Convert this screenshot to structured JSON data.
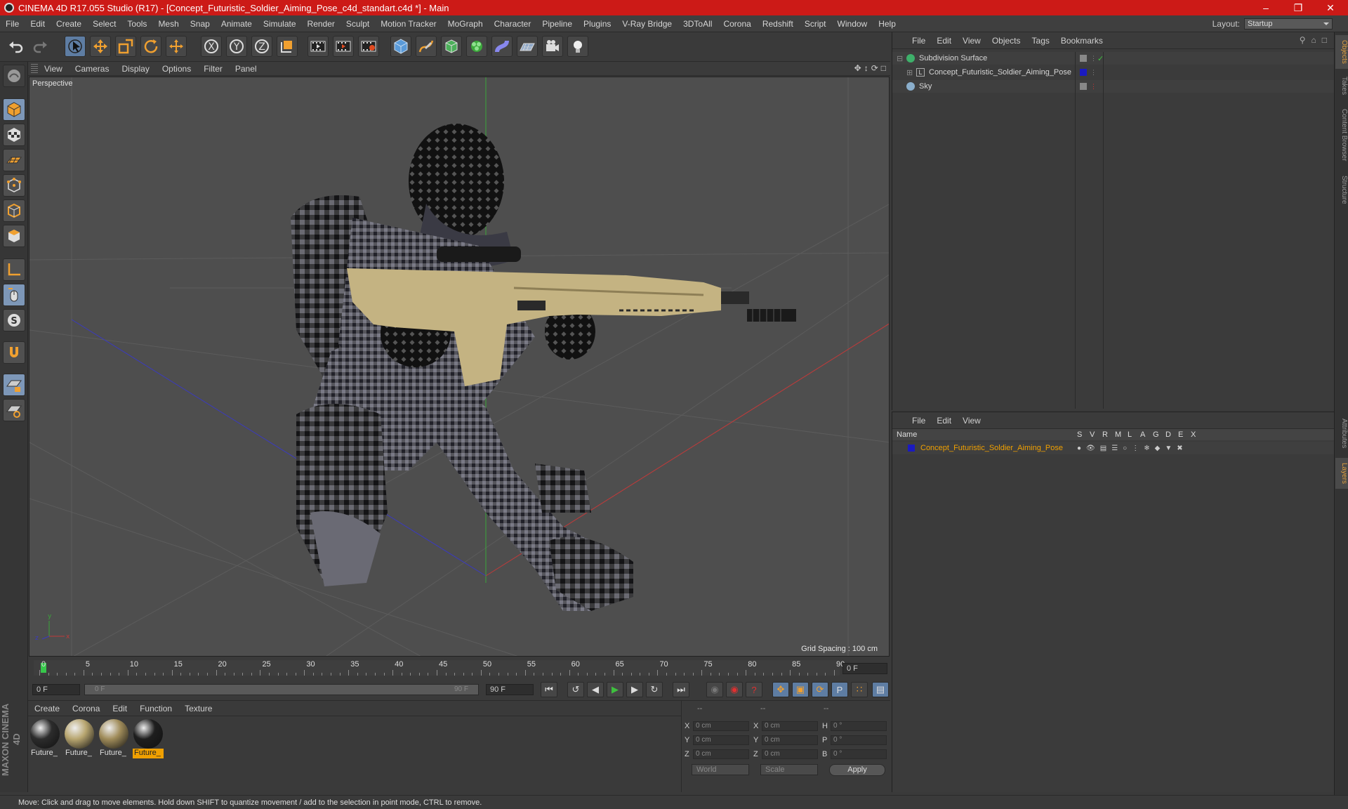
{
  "title": "CINEMA 4D R17.055 Studio (R17) - [Concept_Futuristic_Soldier_Aiming_Pose_c4d_standart.c4d *] - Main",
  "menu": [
    "File",
    "Edit",
    "Create",
    "Select",
    "Tools",
    "Mesh",
    "Snap",
    "Animate",
    "Simulate",
    "Render",
    "Sculpt",
    "Motion Tracker",
    "MoGraph",
    "Character",
    "Pipeline",
    "Plugins",
    "V-Ray Bridge",
    "3DToAll",
    "Corona",
    "Redshift",
    "Script",
    "Window",
    "Help"
  ],
  "layout": {
    "label": "Layout:",
    "value": "Startup"
  },
  "viewport": {
    "menu": [
      "View",
      "Cameras",
      "Display",
      "Options",
      "Filter",
      "Panel"
    ],
    "label": "Perspective",
    "grid_spacing": "Grid Spacing : 100 cm"
  },
  "timeline": {
    "ticks": [
      "0",
      "5",
      "10",
      "15",
      "20",
      "25",
      "30",
      "35",
      "40",
      "45",
      "50",
      "55",
      "60",
      "65",
      "70",
      "75",
      "80",
      "85",
      "90"
    ],
    "current_frame": "0 F",
    "start_field": "0 F",
    "slider_start": "0 F",
    "slider_end": "90 F",
    "end_field": "90 F"
  },
  "materials": {
    "menu": [
      "Create",
      "Corona",
      "Edit",
      "Function",
      "Texture"
    ],
    "items": [
      {
        "name": "Future_",
        "color": "#2c2c2c"
      },
      {
        "name": "Future_",
        "color": "#b8a670"
      },
      {
        "name": "Future_",
        "color": "#a08c5a"
      },
      {
        "name": "Future_",
        "color": "#1e1e1e"
      }
    ]
  },
  "coords": {
    "headers": [
      "--",
      "--",
      "--"
    ],
    "rows": [
      {
        "a1": "X",
        "v1": "0 cm",
        "a2": "X",
        "v2": "0 cm",
        "a3": "H",
        "v3": "0 °"
      },
      {
        "a1": "Y",
        "v1": "0 cm",
        "a2": "Y",
        "v2": "0 cm",
        "a3": "P",
        "v3": "0 °"
      },
      {
        "a1": "Z",
        "v1": "0 cm",
        "a2": "Z",
        "v2": "0 cm",
        "a3": "B",
        "v3": "0 °"
      }
    ],
    "mode1": "World",
    "mode2": "Scale",
    "apply": "Apply"
  },
  "objects": {
    "menu": [
      "File",
      "Edit",
      "View",
      "Objects",
      "Tags",
      "Bookmarks"
    ],
    "items": [
      {
        "name": "Subdivision Surface",
        "color": "#ccc"
      },
      {
        "name": "Concept_Futuristic_Soldier_Aiming_Pose",
        "color": "#ccc"
      },
      {
        "name": "Sky",
        "color": "#ccc"
      }
    ]
  },
  "layers": {
    "menu": [
      "File",
      "Edit",
      "View"
    ],
    "columns": [
      "Name",
      "S",
      "V",
      "R",
      "M",
      "L",
      "A",
      "G",
      "D",
      "E",
      "X"
    ],
    "items": [
      {
        "name": "Concept_Futuristic_Soldier_Aiming_Pose",
        "color": "#f0a000"
      }
    ]
  },
  "sidetabs": [
    "Objects",
    "Takes",
    "Content Browser",
    "Structure",
    "Attributes",
    "Layers"
  ],
  "brand": "MAXON CINEMA 4D",
  "status": "Move: Click and drag to move elements. Hold down SHIFT to quantize movement / add to the selection in point mode, CTRL to remove."
}
